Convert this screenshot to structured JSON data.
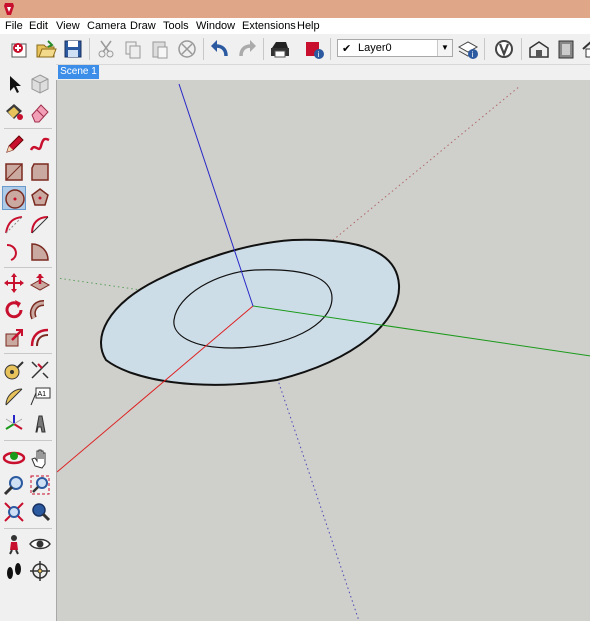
{
  "menu": {
    "file": "File",
    "edit": "Edit",
    "view": "View",
    "camera": "Camera",
    "draw": "Draw",
    "tools": "Tools",
    "window": "Window",
    "extensions": "Extensions",
    "help": "Help"
  },
  "layer": {
    "selected": "Layer0",
    "check": "✔"
  },
  "scene": {
    "tab_label": "Scene 1"
  },
  "colors": {
    "titlebar": "#dfa788",
    "viewport_bg": "#cfcfcb",
    "scene_tab": "#3d8ee9",
    "disk_fill": "#cddde8",
    "red_axis": "#d22",
    "green_axis": "#1a9a1a",
    "blue_axis": "#2727c8"
  },
  "icons": {
    "toolbar": [
      "new-model-icon",
      "open-icon",
      "save-icon",
      "cut-icon",
      "copy-icon",
      "paste-icon",
      "erase-selection-icon",
      "undo-icon",
      "redo-icon",
      "print-icon",
      "model-info-icon",
      "layer-manager-icon",
      "v-ray-icon",
      "warehouse-icon",
      "extension-icon",
      "home-icon"
    ],
    "tools": [
      "select-icon",
      "component-icon",
      "paint-bucket-icon",
      "eraser-icon",
      "pencil-icon",
      "freehand-icon",
      "rectangle-icon",
      "rotated-rectangle-icon",
      "circle-icon",
      "polygon-icon",
      "arc-icon",
      "two-point-arc-icon",
      "three-point-arc-icon",
      "pie-icon",
      "move-icon",
      "push-pull-icon",
      "rotate-icon",
      "follow-me-icon",
      "scale-icon",
      "offset-icon",
      "tape-measure-icon",
      "dimension-icon",
      "protractor-icon",
      "text-icon",
      "axes-icon",
      "3d-text-icon",
      "orbit-icon",
      "pan-icon",
      "zoom-icon",
      "zoom-window-icon",
      "zoom-extents-icon",
      "previous-view-icon",
      "position-camera-icon",
      "look-around-icon",
      "walk-icon",
      "section-plane-icon"
    ]
  }
}
